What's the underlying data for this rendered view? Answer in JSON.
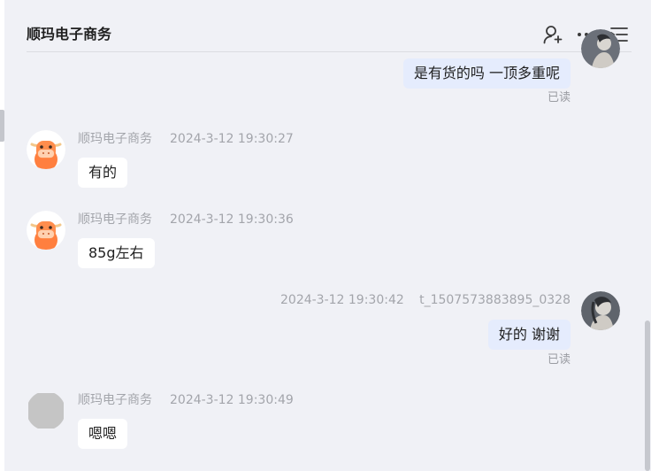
{
  "header": {
    "title": "顺玛电子商务",
    "icons": [
      "add-person-icon",
      "more-icon",
      "list-menu-icon"
    ]
  },
  "messages": [
    {
      "side": "out",
      "text": "是有货的吗 一顶多重呢",
      "status": "已读"
    },
    {
      "side": "in",
      "sender": "顺玛电子商务",
      "time": "2024-3-12 19:30:27",
      "text": "有的"
    },
    {
      "side": "in",
      "sender": "顺玛电子商务",
      "time": "2024-3-12 19:30:36",
      "text": "85g左右"
    },
    {
      "side": "out",
      "sender": "t_1507573883895_0328",
      "time": "2024-3-12 19:30:42",
      "text": "好的 谢谢",
      "status": "已读"
    },
    {
      "side": "in",
      "sender": "顺玛电子商务",
      "time": "2024-3-12 19:30:49",
      "text": "嗯嗯"
    }
  ],
  "colors": {
    "background": "#f0f1f6",
    "incoming_bubble": "#ffffff",
    "outgoing_bubble": "#e5ecfd",
    "meta_text": "#a3a5ab",
    "bot_avatar": "#ff7f3f"
  }
}
